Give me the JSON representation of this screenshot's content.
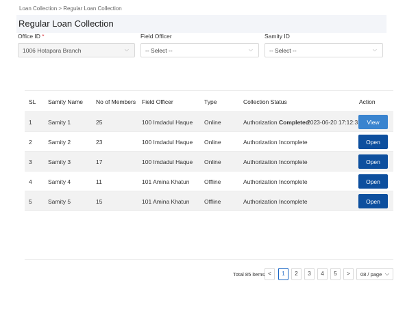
{
  "breadcrumb": "Loan Collection > Regular Loan Collection",
  "page_title": "Regular Loan Collection",
  "filters": {
    "office": {
      "label": "Office ID",
      "required_mark": "*",
      "value": "1006 Hotapara Branch"
    },
    "field_officer": {
      "label": "Field Officer",
      "value": "-- Select --"
    },
    "samity": {
      "label": "Samity ID",
      "value": "-- Select --"
    }
  },
  "table": {
    "headers": [
      "SL",
      "Samity Name",
      "No of Members",
      "Field Officer",
      "Type",
      "Collection Status",
      "Action"
    ],
    "rows": [
      {
        "sl": "1",
        "name": "Samity 1",
        "members": "25",
        "officer": "100 Imdadul Haque",
        "type": "Online",
        "status_prefix": "Authorization",
        "status_word": "Completed",
        "timestamp": "2023-06-20 17:12:37",
        "action": "View"
      },
      {
        "sl": "2",
        "name": "Samity 2",
        "members": "23",
        "officer": "100 Imdadul Haque",
        "type": "Online",
        "status_prefix": "Authorization",
        "status_word": "Incomplete",
        "timestamp": "",
        "action": "Open"
      },
      {
        "sl": "3",
        "name": "Samity 3",
        "members": "17",
        "officer": "100 Imdadul Haque",
        "type": "Online",
        "status_prefix": "Authorization",
        "status_word": "Incomplete",
        "timestamp": "",
        "action": "Open"
      },
      {
        "sl": "4",
        "name": "Samity 4",
        "members": "11",
        "officer": "101 Amina Khatun",
        "type": "Offline",
        "status_prefix": "Authorization",
        "status_word": "Incomplete",
        "timestamp": "",
        "action": "Open"
      },
      {
        "sl": "5",
        "name": "Samity 5",
        "members": "15",
        "officer": "101 Amina Khatun",
        "type": "Offline",
        "status_prefix": "Authorization",
        "status_word": "Incomplete",
        "timestamp": "",
        "action": "Open"
      }
    ]
  },
  "pagination": {
    "total": "Total 85 items",
    "prev": "<",
    "pages": [
      "1",
      "2",
      "3",
      "4",
      "5"
    ],
    "active": "1",
    "next": ">",
    "page_size": "08 / page"
  },
  "icons": {
    "select_chevron": "chevron-down-icon",
    "prev": "chevron-left-icon",
    "next": "chevron-right-icon"
  },
  "colors": {
    "primary_button": "#0d4f9e",
    "view_button": "#3a84cf",
    "required": "#d9363e",
    "active_page": "#1a66c4"
  }
}
